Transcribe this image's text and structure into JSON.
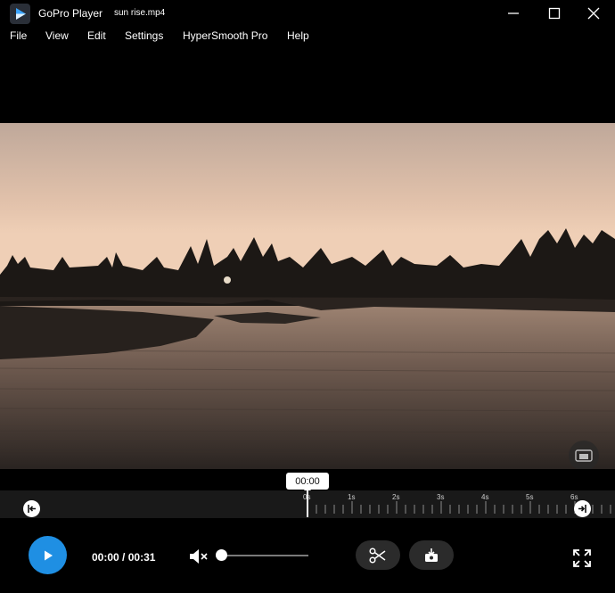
{
  "titlebar": {
    "app_name": "GoPro Player",
    "file_name": "sun rise.mp4"
  },
  "menu": [
    {
      "label": "File"
    },
    {
      "label": "View"
    },
    {
      "label": "Edit"
    },
    {
      "label": "Settings"
    },
    {
      "label": "HyperSmooth Pro"
    },
    {
      "label": "Help"
    }
  ],
  "timeline": {
    "current_bubble": "00:00",
    "ticks": [
      "0s",
      "1s",
      "2s",
      "3s",
      "4s",
      "5s",
      "6s"
    ]
  },
  "controls": {
    "time_current": "00:00",
    "time_separator": "/",
    "time_total": "00:31",
    "volume_level": 0.0,
    "muted": true
  },
  "colors": {
    "accent": "#1f8fe3",
    "background": "#000000",
    "timeline_bg": "#191919",
    "pill_bg": "#2b2b2b"
  },
  "icons": {
    "app": "gopro-player-icon",
    "minimize": "minimize-icon",
    "maximize": "maximize-icon",
    "close": "close-icon",
    "pip": "picture-in-picture-icon",
    "trim_start": "trim-start-icon",
    "trim_end": "trim-end-icon",
    "play": "play-icon",
    "mute": "speaker-muted-icon",
    "trim": "scissors-icon",
    "snapshot": "frame-grab-icon",
    "fullscreen": "fullscreen-icon"
  }
}
